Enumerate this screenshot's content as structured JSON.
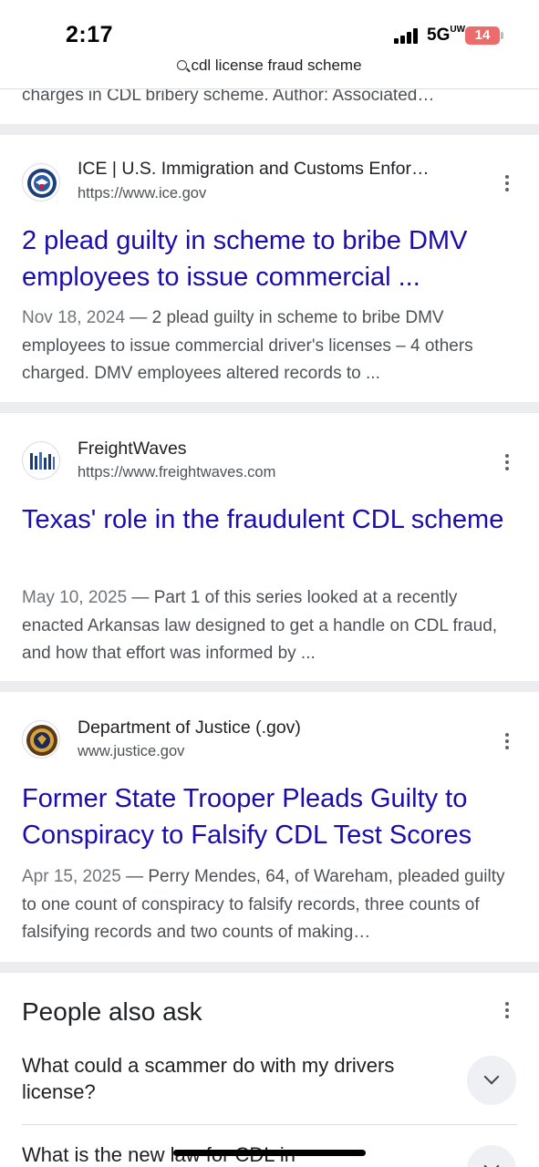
{
  "status_bar": {
    "time": "2:17",
    "network": "5G",
    "network_suffix": "UW",
    "battery": "14"
  },
  "search": {
    "query": "cdl license fraud scheme"
  },
  "clipped_snippet": "charges in CDL bribery scheme. Author: Associated…",
  "results": [
    {
      "site_name": "ICE | U.S. Immigration and Customs Enfor…",
      "url": "https://www.ice.gov",
      "title": "2 plead guilty in scheme to bribe DMV employees to issue commercial ...",
      "date": "Nov 18, 2024",
      "snippet": "2 plead guilty in scheme to bribe DMV employees to issue commercial driver's licenses – 4 others charged. DMV employees altered records to ...",
      "favicon": "ice-seal-icon"
    },
    {
      "site_name": "FreightWaves",
      "url": "https://www.freightwaves.com",
      "title": "Texas' role in the fraudulent CDL scheme",
      "date": "May 10, 2025",
      "snippet": "Part 1 of this series looked at a recently enacted Arkansas law designed to get a handle on CDL fraud, and how that effort was informed by ...",
      "favicon": "freightwaves-logo-icon"
    },
    {
      "site_name": "Department of Justice (.gov)",
      "url": "www.justice.gov",
      "title": "Former State Trooper Pleads Guilty to Conspiracy to Falsify CDL Test Scores",
      "date": "Apr 15, 2025",
      "snippet": "Perry Mendes, 64, of Wareham, pleaded guilty to one count of conspiracy to falsify records, three counts of falsifying records and two counts of making…",
      "favicon": "doj-seal-icon"
    }
  ],
  "people_also_ask": {
    "heading": "People also ask",
    "questions": [
      "What could a scammer do with my drivers license?",
      "What is the new law for CDL in"
    ]
  },
  "colors": {
    "link": "#1a0dab",
    "snippet": "#4d5156",
    "separator": "#ecedef",
    "battery": "#ee6b6b"
  }
}
